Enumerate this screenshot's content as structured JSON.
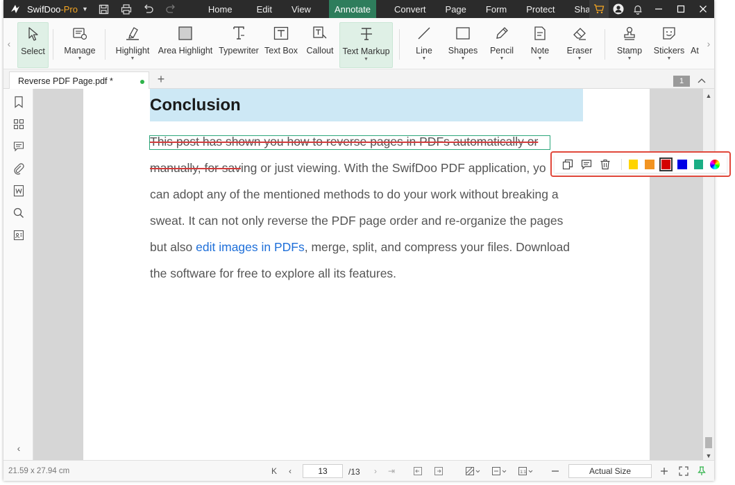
{
  "app": {
    "name": "SwifDoo",
    "edition": "-Pro"
  },
  "menu": {
    "tabs": [
      "Home",
      "Edit",
      "View",
      "Annotate",
      "Convert",
      "Page",
      "Form",
      "Protect",
      "Share"
    ],
    "active": "Annotate"
  },
  "ribbon": {
    "tools": [
      {
        "label": "Select",
        "icon": "cursor-icon",
        "dropdown": false,
        "active": true
      },
      {
        "label": "Manage",
        "icon": "manage-icon",
        "dropdown": true
      },
      {
        "label": "Highlight",
        "icon": "highlighter-icon",
        "dropdown": true
      },
      {
        "label": "Area Highlight",
        "icon": "area-highlight-icon",
        "dropdown": false
      },
      {
        "label": "Typewriter",
        "icon": "typewriter-icon",
        "dropdown": false
      },
      {
        "label": "Text Box",
        "icon": "textbox-icon",
        "dropdown": false
      },
      {
        "label": "Callout",
        "icon": "callout-icon",
        "dropdown": false
      },
      {
        "label": "Text Markup",
        "icon": "text-markup-icon",
        "dropdown": true,
        "active": true
      },
      {
        "label": "Line",
        "icon": "line-icon",
        "dropdown": true
      },
      {
        "label": "Shapes",
        "icon": "shapes-icon",
        "dropdown": true
      },
      {
        "label": "Pencil",
        "icon": "pencil-icon",
        "dropdown": true
      },
      {
        "label": "Note",
        "icon": "note-icon",
        "dropdown": true
      },
      {
        "label": "Eraser",
        "icon": "eraser-icon",
        "dropdown": true
      },
      {
        "label": "Stamp",
        "icon": "stamp-icon",
        "dropdown": true
      },
      {
        "label": "Stickers",
        "icon": "stickers-icon",
        "dropdown": true
      },
      {
        "label": "At",
        "icon": "attachment-icon",
        "dropdown": false
      }
    ]
  },
  "document": {
    "tab_title": "Reverse PDF Page.pdf *",
    "page_badge": "1",
    "heading": "Conclusion",
    "lines": {
      "l1_strike": "This post has shown you how to reverse pages in PDFs automatically or",
      "l2_strike": "manually, for sav",
      "l2_rest": "ing or just viewing. With the SwifDoo PDF application, yo",
      "l3": "can adopt any of the mentioned methods to do your work without breaking a",
      "l4": "sweat. It can not only reverse the PDF page order and re-organize the pages",
      "l5_pre": "but also ",
      "l5_link": "edit images in PDFs",
      "l5_post": ", merge, split, and compress your files. Download",
      "l6": "the software for free to explore all its features."
    }
  },
  "annotation_popup": {
    "actions": [
      "copy-icon",
      "comment-icon",
      "delete-icon"
    ],
    "swatches": [
      "#ffd400",
      "#f29422",
      "#d40000",
      "#0000e6",
      "#1aae84",
      "color-wheel"
    ],
    "selected": "#d40000"
  },
  "statusbar": {
    "page_size": "21.59 x 27.94 cm",
    "current_page": "13",
    "total_pages": "/13",
    "zoom": "Actual Size"
  }
}
